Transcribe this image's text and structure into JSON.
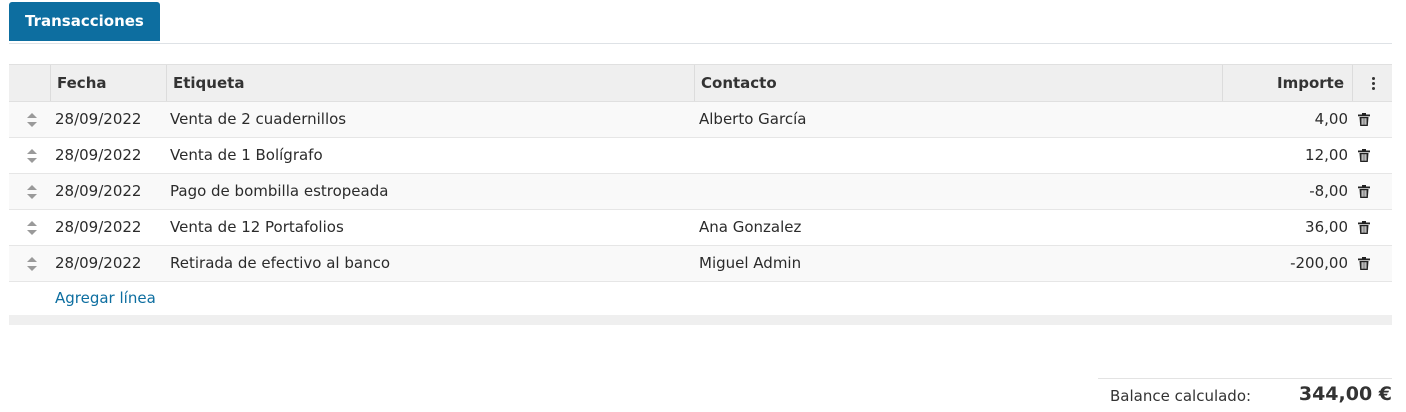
{
  "tabs": [
    {
      "label": "Transacciones",
      "active": true
    }
  ],
  "table": {
    "columns": {
      "fecha": "Fecha",
      "etiqueta": "Etiqueta",
      "contacto": "Contacto",
      "importe": "Importe"
    },
    "rows": [
      {
        "fecha": "28/09/2022",
        "etiqueta": "Venta de 2 cuadernillos",
        "contacto": "Alberto García",
        "importe": "4,00"
      },
      {
        "fecha": "28/09/2022",
        "etiqueta": "Venta de 1 Bolígrafo",
        "contacto": "",
        "importe": "12,00"
      },
      {
        "fecha": "28/09/2022",
        "etiqueta": "Pago de bombilla estropeada",
        "contacto": "",
        "importe": "-8,00"
      },
      {
        "fecha": "28/09/2022",
        "etiqueta": "Venta de 12 Portafolios",
        "contacto": "Ana Gonzalez",
        "importe": "36,00"
      },
      {
        "fecha": "28/09/2022",
        "etiqueta": "Retirada de efectivo al banco",
        "contacto": "Miguel Admin",
        "importe": "-200,00"
      }
    ],
    "add_line": "Agregar línea"
  },
  "balance": {
    "label": "Balance calculado:",
    "value": "344,00 €"
  },
  "icons": {
    "row_handle": "sort-handle-icon",
    "delete": "trash-icon",
    "options": "kebab-menu-icon"
  },
  "colors": {
    "accent": "#0d6ea0"
  }
}
